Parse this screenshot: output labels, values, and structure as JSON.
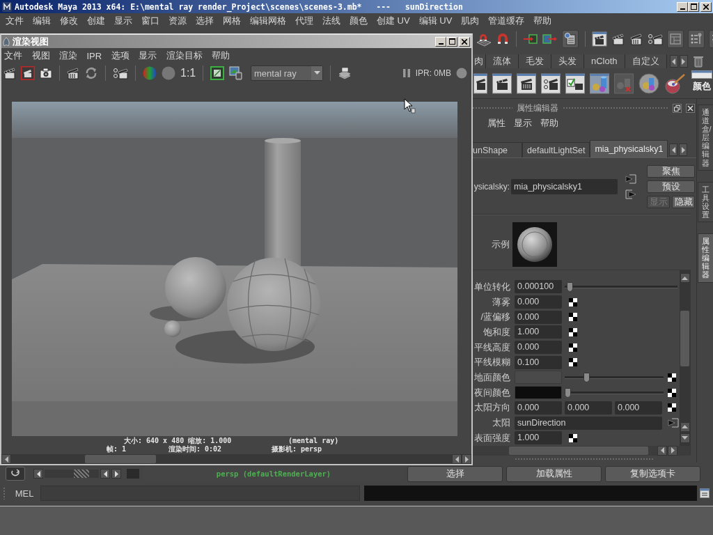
{
  "window": {
    "title": "Autodesk Maya 2013 x64: E:\\mental ray render_Project\\scenes\\scenes-3.mb*   ---   sunDirection"
  },
  "menu_bar": [
    "文件",
    "编辑",
    "修改",
    "创建",
    "显示",
    "窗口",
    "资源",
    "选择",
    "网格",
    "编辑网格",
    "代理",
    "法线",
    "颜色",
    "创建 UV",
    "编辑 UV",
    "肌肉",
    "管道缓存",
    "帮助"
  ],
  "shelf": {
    "tabs": [
      {
        "label": "肉",
        "selected": false
      },
      {
        "label": "流体",
        "selected": false
      },
      {
        "label": "毛发",
        "selected": false
      },
      {
        "label": "头发",
        "selected": false
      },
      {
        "label": "nCloth",
        "selected": false
      },
      {
        "label": "自定义",
        "selected": false
      }
    ],
    "button_label": "颜色"
  },
  "attribute_editor": {
    "title": "属性编辑器",
    "menu": [
      "属性",
      "显示",
      "帮助"
    ],
    "tabs": [
      {
        "label": "unShape",
        "selected": false
      },
      {
        "label": "defaultLightSet",
        "selected": false
      },
      {
        "label": "mia_physicalsky1",
        "selected": true
      }
    ],
    "node_label": "ysicalsky:",
    "node_name": "mia_physicalsky1",
    "buttons": [
      {
        "label": "聚焦",
        "disabled": false
      },
      {
        "label": "预设",
        "disabled": false
      },
      {
        "label": "显示",
        "disabled": true
      },
      {
        "label": "隐藏",
        "disabled": false
      }
    ],
    "sample_label": "示例",
    "attributes": [
      {
        "kind": "slider",
        "label": "单位转化",
        "value": "0.000100",
        "level": 0.02
      },
      {
        "kind": "number",
        "label": "薄雾",
        "value": "0.000"
      },
      {
        "kind": "number",
        "label": "/蓝偏移",
        "value": "0.000"
      },
      {
        "kind": "number",
        "label": "饱和度",
        "value": "1.000"
      },
      {
        "kind": "number",
        "label": "平线高度",
        "value": "0.000"
      },
      {
        "kind": "number",
        "label": "平线模糊",
        "value": "0.100"
      },
      {
        "kind": "color",
        "label": "地面颜色",
        "color": "#4a4a4a",
        "level": 0.2
      },
      {
        "kind": "color",
        "label": "夜间颜色",
        "color": "#0d0d0d",
        "level": 0
      },
      {
        "kind": "vector",
        "label": "太阳方向",
        "values": [
          "0.000",
          "0.000",
          "0.000"
        ]
      },
      {
        "kind": "link",
        "label": "太阳",
        "value": "sunDirection"
      },
      {
        "kind": "number",
        "label": "表面强度",
        "value": "1.000"
      }
    ],
    "footer_buttons": [
      "选择",
      "加载属性",
      "复制选项卡"
    ]
  },
  "side_tabs": [
    {
      "label": "通道盒/层编辑器",
      "selected": false
    },
    {
      "label": "工具设置",
      "selected": false
    },
    {
      "label": "属性编辑器",
      "selected": true
    }
  ],
  "render_view": {
    "title": "渲染视图",
    "menu": [
      "文件",
      "视图",
      "渲染",
      "IPR",
      "选项",
      "显示",
      "渲染目标",
      "帮助"
    ],
    "scale_label": "1:1",
    "renderer": "mental ray",
    "ipr_memory": "IPR: 0MB",
    "info": {
      "size": "大小: 640 x 480 缩放: 1.000",
      "renderer": "(mental ray)",
      "frame": "帧: 1",
      "render_time": "渲染时间: 0:02",
      "camera": "摄影机: persp"
    }
  },
  "time_slider": {
    "range_slider": {
      "level": 0.75
    },
    "layer": "persp (defaultRenderLayer)"
  },
  "command_line": {
    "label": "MEL"
  }
}
